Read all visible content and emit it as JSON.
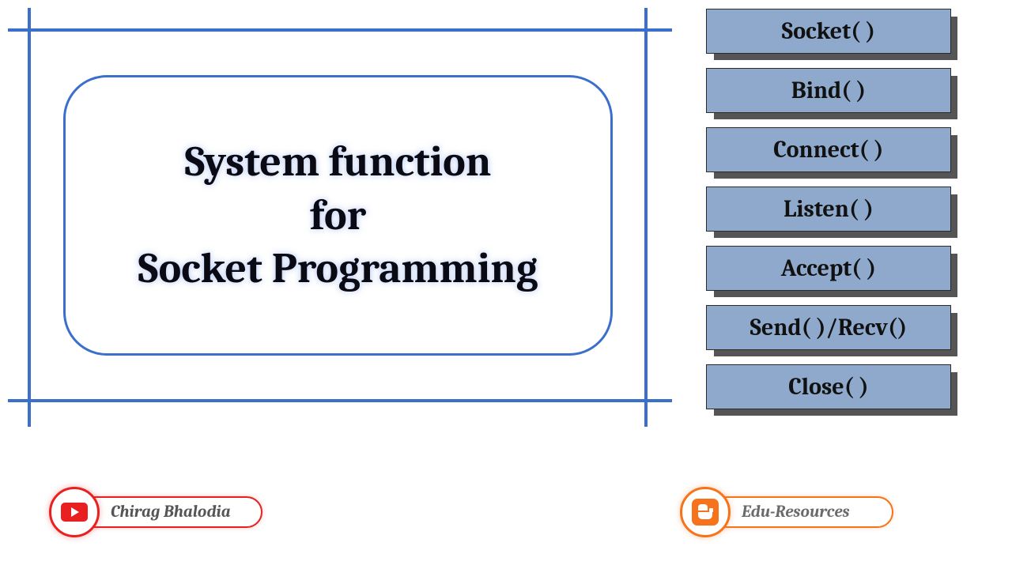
{
  "title": {
    "line1": "System function",
    "line2": "for",
    "line3": "Socket Programming"
  },
  "functions": [
    "Socket( )",
    "Bind( )",
    "Connect( )",
    "Listen( )",
    "Accept( )",
    "Send( )/Recv()",
    "Close( )"
  ],
  "links": {
    "youtube_label": "Chirag Bhalodia",
    "blogger_label": "Edu-Resources"
  },
  "colors": {
    "frame_blue": "#3b6fcc",
    "box_fill": "#8ea9cc",
    "youtube_red": "#e8201f",
    "blogger_orange": "#f6731c"
  }
}
